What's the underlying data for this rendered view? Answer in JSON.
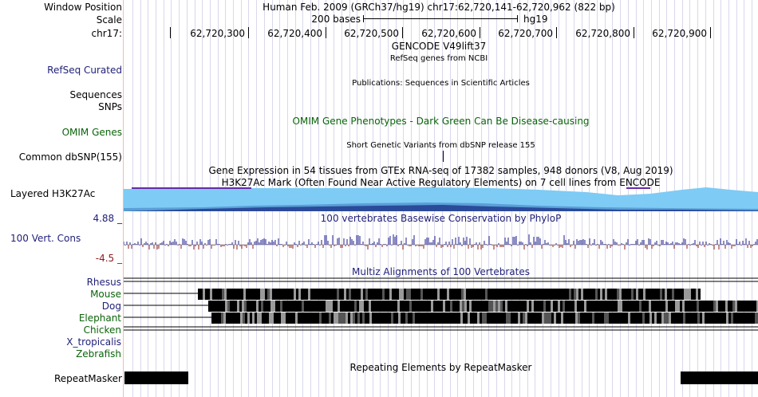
{
  "header": {
    "window_position_label": "Window Position",
    "window_position_text": "Human Feb. 2009 (GRCh37/hg19)   chr17:62,720,141-62,720,962 (822 bp)",
    "scale_label": "Scale",
    "scale_text": "200 bases",
    "assembly": "hg19",
    "chrom_label": "chr17:",
    "ruler_ticks": [
      "62,720,300",
      "62,720,400",
      "62,720,500",
      "62,720,600",
      "62,720,700",
      "62,720,800",
      "62,720,900"
    ]
  },
  "tracks": {
    "gencode_title": "GENCODE V49lift37",
    "refseq_subtitle": "RefSeq genes from NCBI",
    "refseq_label": "RefSeq Curated",
    "publications_title": "Publications: Sequences in Scientific Articles",
    "sequences_label": "Sequences",
    "snps_label": "SNPs",
    "omim_label": "OMIM Genes",
    "omim_title": "OMIM Gene Phenotypes - Dark Green Can Be Disease-causing",
    "dbsnp_title": "Short Genetic Variants from dbSNP release 155",
    "dbsnp_label": "Common dbSNP(155)",
    "gtex_title": "Gene Expression in 54 tissues from GTEx RNA-seq of 17382 samples, 948 donors (V8, Aug 2019)",
    "h3k27ac_title": "H3K27Ac Mark (Often Found Near Active Regulatory Elements) on 7 cell lines from ENCODE",
    "h3k27ac_label": "Layered H3K27Ac",
    "cons_max": "4.88 _",
    "cons_title": "100 vertebrates Basewise Conservation by PhyloP",
    "cons_label": "100 Vert. Cons",
    "cons_min": "-4.5 _",
    "multiz_title": "Multiz Alignments of 100 Vertebrates",
    "species": [
      "Rhesus",
      "Mouse",
      "Dog",
      "Elephant",
      "Chicken",
      "X_tropicalis",
      "Zebrafish"
    ],
    "repeat_title": "Repeating Elements by RepeatMasker",
    "repeat_label": "RepeatMasker"
  },
  "colors": {
    "navy_label": "#1f1f78",
    "green_label": "#0a640a",
    "phylop_pos": "#1b1b8c",
    "phylop_neg": "#8c1b1b",
    "h3k27ac_light": "#7ecbf5",
    "h3k27ac_mid": "#5a9fd6",
    "h3k27ac_dark": "#2b4a9a",
    "h3k27ac_top": "#6a2aa8",
    "grid": "#d8d8ec",
    "separator": "#f4b8b8"
  }
}
